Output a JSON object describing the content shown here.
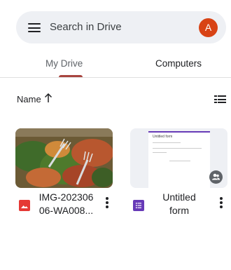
{
  "header": {
    "search_placeholder": "Search in Drive",
    "avatar_letter": "A",
    "avatar_color": "#d84315",
    "menu_icon": "hamburger-menu-icon"
  },
  "tabs": [
    {
      "label": "My Drive",
      "active": true
    },
    {
      "label": "Computers",
      "active": false
    }
  ],
  "accent_color": "#a8453f",
  "sort": {
    "label": "Name",
    "direction_icon": "arrow-up-icon",
    "view_icon": "list-view-icon"
  },
  "files": [
    {
      "name_line1": "IMG-202306",
      "name_line2": "06-WA008...",
      "type_icon": "image-file-icon",
      "type_color": "#e53935",
      "preview": "photo"
    },
    {
      "name_line1": "Untitled",
      "name_line2": "form",
      "type_icon": "forms-file-icon",
      "type_color": "#673ab7",
      "preview": "form",
      "preview_title": "Untitled form",
      "shared": true
    }
  ]
}
